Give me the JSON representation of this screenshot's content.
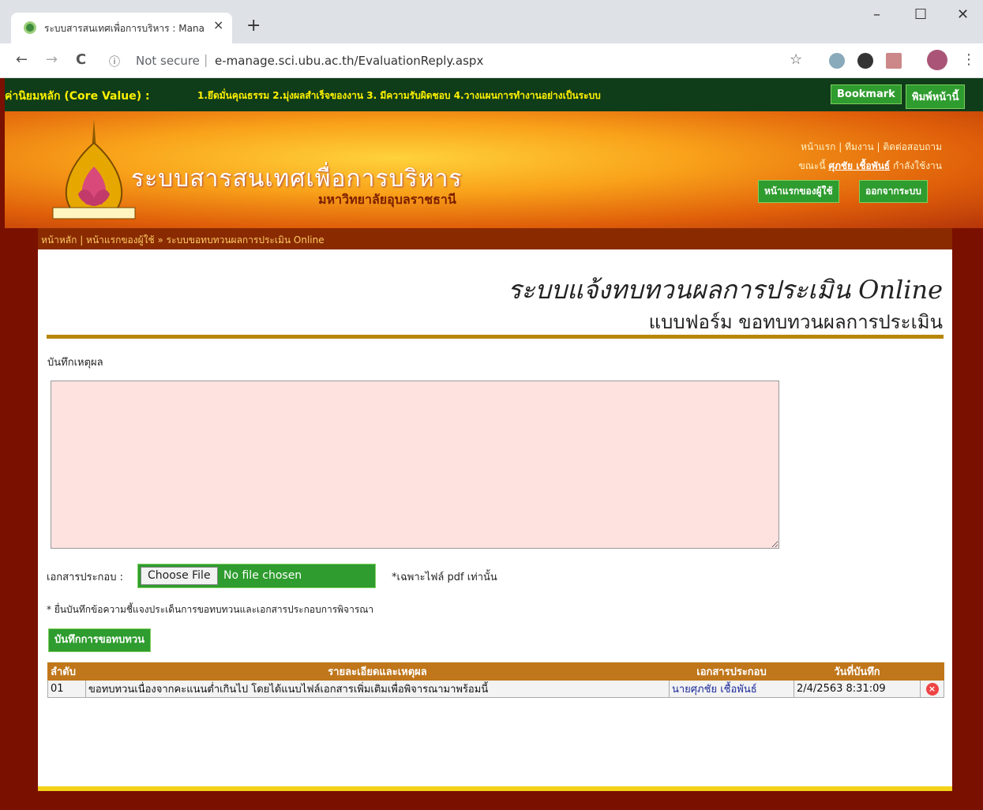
{
  "browser": {
    "tab_title": "ระบบสารสนเทศเพื่อการบริหาร : Mana",
    "tab_close": "×",
    "new_tab": "+",
    "minimize": "–",
    "maximize": "☐",
    "close": "✕",
    "back": "←",
    "forward": "→",
    "reload": "C",
    "info_icon": "ⓘ",
    "not_secure": "Not secure",
    "separator": "|",
    "url": "e-manage.sci.ubu.ac.th/EvaluationReply.aspx",
    "star": "☆",
    "menu": "⋮"
  },
  "corebar": {
    "label": "ค่านิยมหลัก (Core Value) :",
    "values": "1.ยึดมั่นคุณธรรม 2.มุ่งผลสำเร็จของงาน 3. มีความรับผิดชอบ 4.วางแผนการทำงานอย่างเป็นระบบ",
    "bookmark": "Bookmark",
    "print": "พิมพ์หน้านี้"
  },
  "header": {
    "title": "ระบบสารสนเทศเพื่อการบริหาร",
    "university": "มหาวิทยาลัยอุบลราชธานี",
    "links": "หน้าแรก | ทีมงาน | ติดต่อสอบถาม",
    "user_prefix": "ขณะนี้",
    "user_name": "ศุภชัย เชื้อพันธ์",
    "user_suffix": "กำลังใช้งาน",
    "home_user_button": "หน้าแรกของผู้ใช้",
    "logout_button": "ออกจากระบบ"
  },
  "breadcrumb": "หน้าหลัก | หน้าแรกของผู้ใช้ » ระบบขอทบทวนผลการประเมิน Online",
  "page": {
    "title": "ระบบแจ้งทบทวนผลการประเมิน Online",
    "subtitle": "แบบฟอร์ม ขอทบทวนผลการประเมิน",
    "note_label": "บันทึกเหตุผล",
    "note_value": "",
    "attach_label": "เอกสารประกอบ :",
    "choose_file": "Choose File",
    "no_file": "No file chosen",
    "pdf_note": "*เฉพาะไฟล์ pdf เท่านั้น",
    "hint": "* ยื่นบันทึกข้อความชี้แจงประเด็นการขอทบทวนและเอกสารประกอบการพิจารณา",
    "save_button": "บันทึกการขอทบทวน"
  },
  "table": {
    "headers": [
      "ลำดับ",
      "รายละเอียดและเหตุผล",
      "เอกสารประกอบ",
      "วันที่บันทึก",
      ""
    ],
    "rows": [
      {
        "no": "01",
        "detail": "ขอทบทวนเนื่องจากคะแนนต่ำเกินไป โดยได้แนบไฟล์เอกสารเพิ่มเติมเพื่อพิจารณามาพร้อมนี้",
        "doc": "นายศุภชัย เชื้อพันธ์",
        "date": "2/4/2563 8:31:09",
        "delete": "×"
      }
    ]
  },
  "colors": {
    "core_bar": "#0f3d1a",
    "green_button": "#2e9c2e",
    "table_header": "#c0761a",
    "textarea_bg": "#fde2e0"
  }
}
